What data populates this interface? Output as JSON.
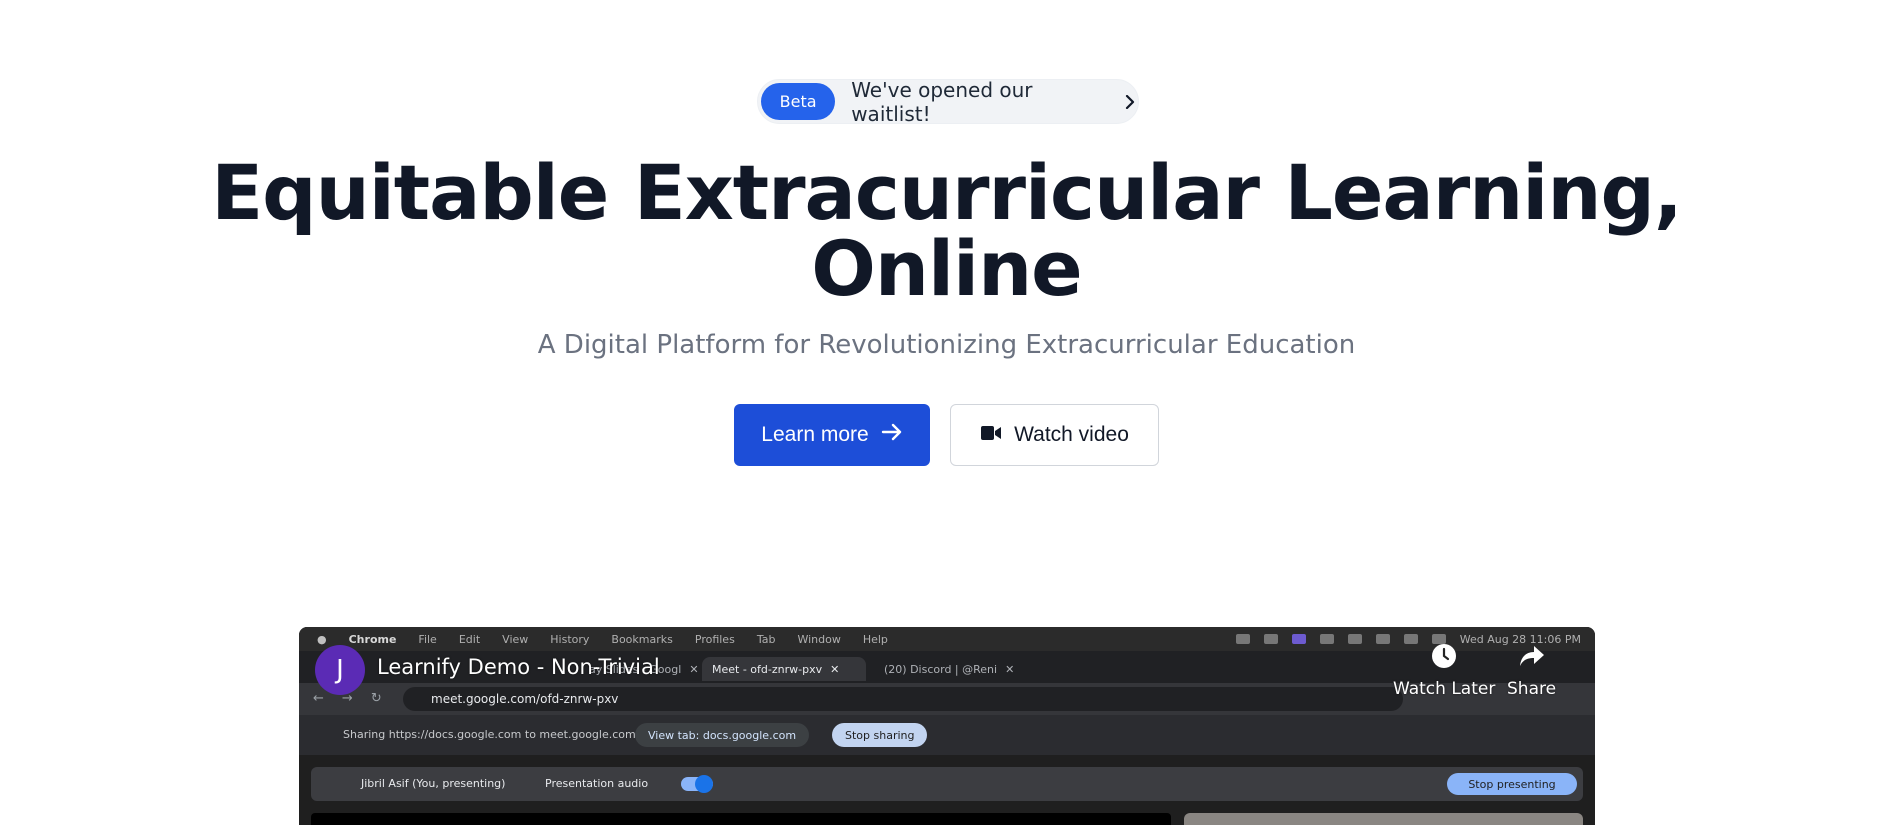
{
  "badge": {
    "pill": "Beta",
    "text": "We've opened our waitlist!",
    "icon": "chevron-right-icon"
  },
  "hero": {
    "title_line1": "Equitable Extracurricular Learning,",
    "title_line2": "Online",
    "subtitle": "A Digital Platform for Revolutionizing Extracurricular Education"
  },
  "buttons": {
    "learn_more": "Learn more",
    "learn_more_icon": "arrow-right-icon",
    "watch_video": "Watch video",
    "watch_video_icon": "video-camera-icon"
  },
  "video": {
    "channel_initial": "J",
    "title": "Learnify Demo - Non-Trivial",
    "watch_later": "Watch Later",
    "share": "Share",
    "screen": {
      "mac_menu": [
        "Chrome",
        "File",
        "Edit",
        "View",
        "History",
        "Bookmarks",
        "Profiles",
        "Tab",
        "Window",
        "Help"
      ],
      "clock": "Wed Aug 28  11:06 PM",
      "tabs": [
        "ay Slides - Googl",
        "Meet - ofd-znrw-pxv",
        "(20) Discord | @Reni"
      ],
      "url": "meet.google.com/ofd-znrw-pxv",
      "sharing_text": "Sharing https://docs.google.com to meet.google.com",
      "view_tab": "View tab: docs.google.com",
      "stop_sharing": "Stop sharing",
      "presenter": "Jibril Asif (You, presenting)",
      "presentation_audio": "Presentation audio",
      "stop_presenting": "Stop presenting"
    }
  },
  "colors": {
    "primary": "#1d4ed8",
    "badge_pill": "#2563eb",
    "title": "#111827",
    "subtitle": "#6b7280"
  }
}
